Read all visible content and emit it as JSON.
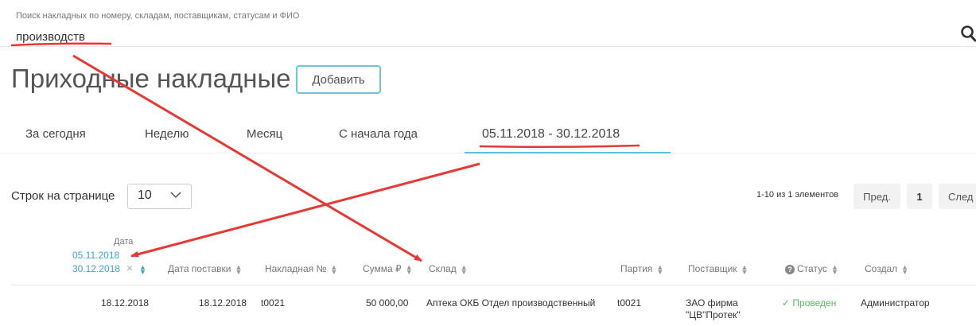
{
  "search": {
    "hint": "Поиск накладных по номеру, складам, поставщикам, статусам и ФИО",
    "value": "производств",
    "icon": "search-icon"
  },
  "page": {
    "title": "Приходные накладные",
    "add_button": "Добавить"
  },
  "tabs": [
    {
      "label": "За сегодня",
      "active": false
    },
    {
      "label": "Неделю",
      "active": false
    },
    {
      "label": "Месяц",
      "active": false
    },
    {
      "label": "С начала года",
      "active": false
    },
    {
      "label": "05.11.2018 - 30.12.2018",
      "active": true
    }
  ],
  "rows_per_page": {
    "label": "Строк на странице",
    "value": "10"
  },
  "pagination": {
    "info": "1-10 из 1 элементов",
    "prev": "Пред.",
    "current": "1",
    "next": "След"
  },
  "table": {
    "date_filter": {
      "header": "Дата",
      "from": "05.11.2018",
      "to": "30.12.2018",
      "clear": "×"
    },
    "columns": [
      "Дата поставки",
      "Накладная №",
      "Сумма ₽",
      "Склад",
      "Партия",
      "Поставщик",
      "Статус",
      "Создал"
    ],
    "rows": [
      {
        "date": "18.12.2018",
        "delivery_date": "18.12.2018",
        "invoice_no": "t0021",
        "sum": "50 000,00",
        "warehouse": "Аптека ОКБ Отдел производственный",
        "batch": "t0021",
        "supplier_line1": "ЗАО фирма",
        "supplier_line2": "\"ЦВ\"Протек\"",
        "status": "Проведен",
        "created_by": "Администратор"
      }
    ]
  },
  "colors": {
    "accent": "#5bc0de",
    "link": "#3aa7c9",
    "success": "#5cb85c",
    "annotation": "#e53935"
  }
}
